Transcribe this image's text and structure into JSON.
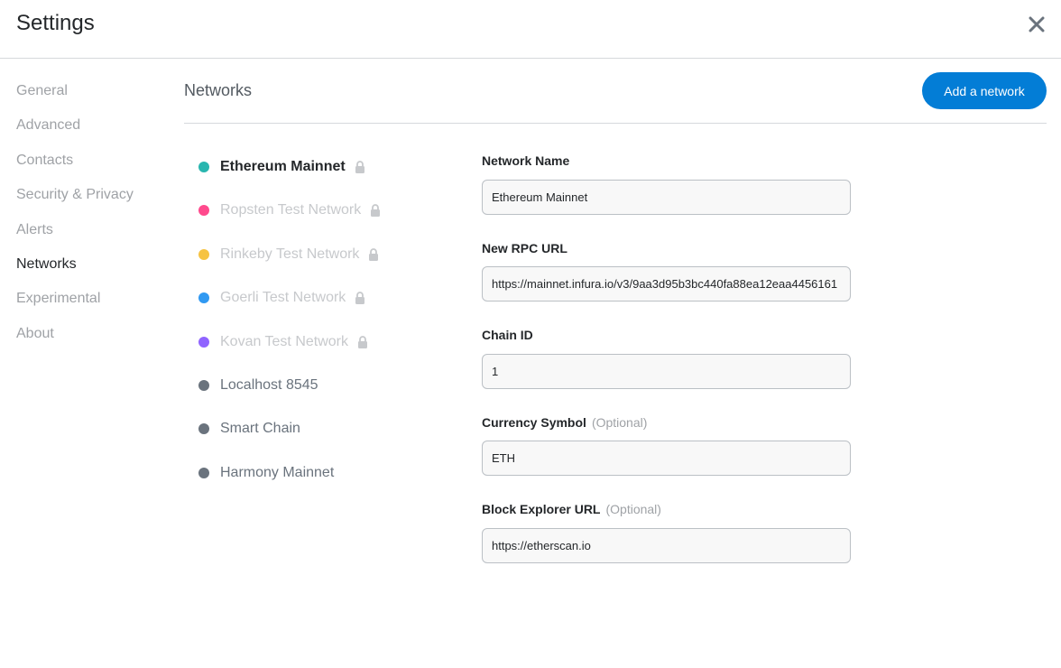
{
  "header": {
    "title": "Settings",
    "close_icon": "close-icon"
  },
  "sidebar": {
    "items": [
      {
        "label": "General",
        "active": false
      },
      {
        "label": "Advanced",
        "active": false
      },
      {
        "label": "Contacts",
        "active": false
      },
      {
        "label": "Security & Privacy",
        "active": false
      },
      {
        "label": "Alerts",
        "active": false
      },
      {
        "label": "Networks",
        "active": true
      },
      {
        "label": "Experimental",
        "active": false
      },
      {
        "label": "About",
        "active": false
      }
    ]
  },
  "content": {
    "title": "Networks",
    "add_button_label": "Add a network"
  },
  "networks": [
    {
      "label": "Ethereum Mainnet",
      "color": "#29b6af",
      "locked": true,
      "selected": true
    },
    {
      "label": "Ropsten Test Network",
      "color": "#ff4a8d",
      "locked": true,
      "selected": false
    },
    {
      "label": "Rinkeby Test Network",
      "color": "#f6c343",
      "locked": true,
      "selected": false
    },
    {
      "label": "Goerli Test Network",
      "color": "#3099f2",
      "locked": true,
      "selected": false
    },
    {
      "label": "Kovan Test Network",
      "color": "#9064ff",
      "locked": true,
      "selected": false
    },
    {
      "label": "Localhost 8545",
      "color": "#6a737d",
      "locked": false,
      "selected": false
    },
    {
      "label": "Smart Chain",
      "color": "#6a737d",
      "locked": false,
      "selected": false
    },
    {
      "label": "Harmony Mainnet",
      "color": "#6a737d",
      "locked": false,
      "selected": false
    }
  ],
  "form": {
    "network_name": {
      "label": "Network Name",
      "value": "Ethereum Mainnet"
    },
    "rpc_url": {
      "label": "New RPC URL",
      "value": "https://mainnet.infura.io/v3/9aa3d95b3bc440fa88ea12eaa4456161"
    },
    "chain_id": {
      "label": "Chain ID",
      "value": "1"
    },
    "currency_symbol": {
      "label": "Currency Symbol",
      "optional": "(Optional)",
      "value": "ETH"
    },
    "block_explorer": {
      "label": "Block Explorer URL",
      "optional": "(Optional)",
      "value": "https://etherscan.io"
    }
  },
  "colors": {
    "accent": "#037dd6",
    "text_primary": "#24272a",
    "text_muted": "#9fa2a6"
  }
}
